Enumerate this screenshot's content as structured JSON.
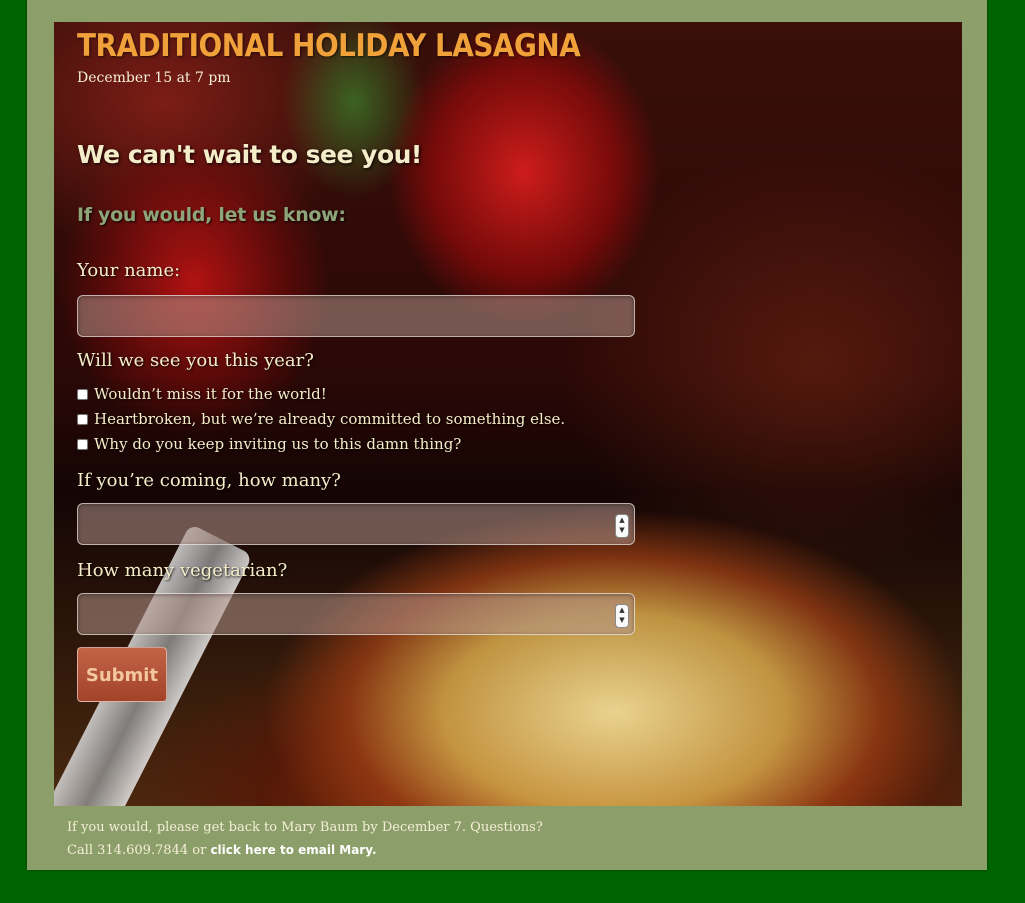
{
  "event": {
    "title": "TRADITIONAL HOLIDAY LASAGNA",
    "date": "December 15 at 7 pm"
  },
  "form": {
    "welcome": "We can't wait to see you!",
    "prompt": "If you would, let us know:",
    "name_label": "Your name:",
    "name_value": "",
    "attend_label": "Will we see you this year?",
    "options": [
      "Wouldn’t miss it for the world!",
      "Heartbroken, but we’re already committed to something else.",
      "Why do you keep inviting us to this damn thing?"
    ],
    "coming_label": "If you’re coming, how many?",
    "coming_value": "",
    "veg_label": "How many vegetarian?",
    "veg_value": "",
    "submit_label": "Submit"
  },
  "footer": {
    "line1": "If you would, please get back to Mary Baum by December 7. Questions?",
    "line2_prefix": "Call 314.609.7844 or",
    "email_link": "click here to email Mary."
  },
  "icons": {
    "stepper": "number-stepper-icon"
  }
}
